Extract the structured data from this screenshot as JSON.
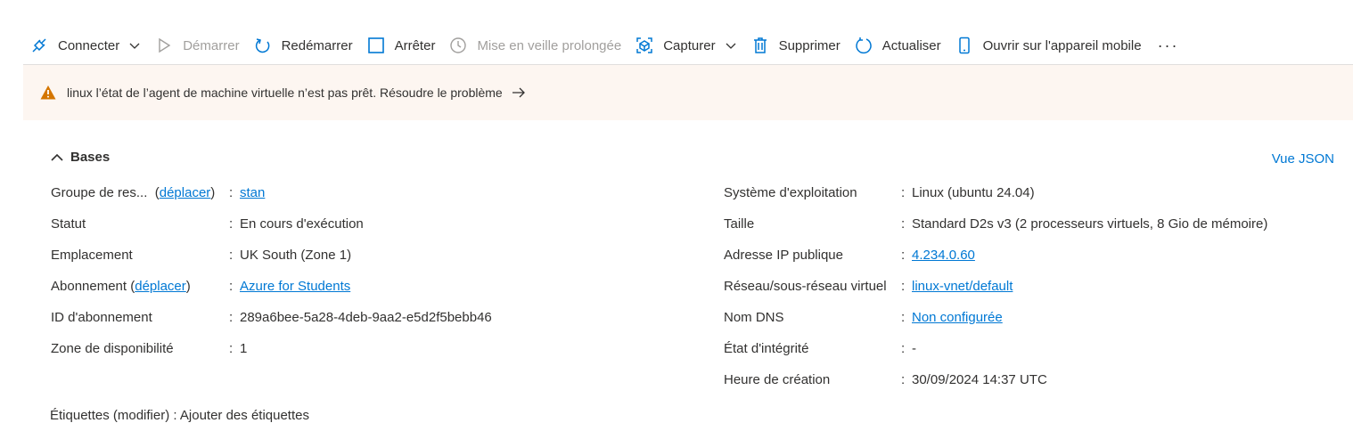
{
  "toolbar": {
    "connect": "Connecter",
    "start": "Démarrer",
    "restart": "Redémarrer",
    "stop": "Arrêter",
    "hibernate": "Mise en veille prolongée",
    "capture": "Capturer",
    "delete": "Supprimer",
    "refresh": "Actualiser",
    "mobile": "Ouvrir sur l'appareil mobile",
    "more": "···"
  },
  "banner": {
    "text": "linux l’état de l’agent de machine virtuelle n’est pas prêt. Résoudre le problème",
    "arrow": "→"
  },
  "section": {
    "title": "Bases",
    "json_view": "Vue JSON"
  },
  "left": {
    "rg_label": "Groupe de res...",
    "rg_move_open": "(",
    "rg_move": "déplacer",
    "rg_move_close": ")",
    "rg_value": "stan",
    "status_label": "Statut",
    "status_value": "En cours d'exécution",
    "location_label": "Emplacement",
    "location_value": "UK South (Zone 1)",
    "sub_label": "Abonnement (",
    "sub_move": "déplacer",
    "sub_close": ")",
    "sub_value": "Azure for Students",
    "subid_label": "ID d'abonnement",
    "subid_value": "289a6bee-5a28-4deb-9aa2-e5d2f5bebb46",
    "zone_label": "Zone de disponibilité",
    "zone_value": "1",
    "tags_partial": "Étiquettes (modifier)   :   Ajouter des étiquettes"
  },
  "right": {
    "os_label": "Système d'exploitation",
    "os_value": "Linux (ubuntu 24.04)",
    "size_label": "Taille",
    "size_value": "Standard D2s v3 (2 processeurs virtuels, 8 Gio de mémoire)",
    "ip_label": "Adresse IP publique",
    "ip_value": "4.234.0.60",
    "vnet_label": "Réseau/sous-réseau virtuel",
    "vnet_value": "linux-vnet/default",
    "dns_label": "Nom DNS",
    "dns_value": "Non configurée",
    "health_label": "État d'intégrité",
    "health_value": "-",
    "created_label": "Heure de création",
    "created_value": "30/09/2024 14:37 UTC"
  },
  "colon": ":",
  "colors": {
    "link": "#0078d4",
    "warning": "#d47500",
    "banner_bg": "#fdf6f1",
    "icon_blue": "#0078d4"
  }
}
